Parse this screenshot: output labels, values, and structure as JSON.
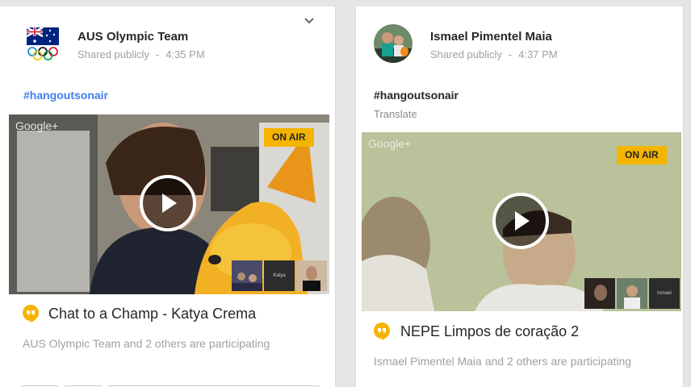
{
  "posts": [
    {
      "author": "AUS Olympic Team",
      "visibility": "Shared publicly",
      "separator": "-",
      "time": "4:35 PM",
      "hashtag": "#hangoutsonair",
      "video": {
        "watermark": "Google+",
        "status_badge": "ON AIR",
        "thumb_label": "Katya"
      },
      "hangout_title": "Chat to a Champ - Katya Crema",
      "participants_text": "AUS Olympic Team and 2 others are participating"
    },
    {
      "author": "Ismael Pimentel Maia",
      "visibility": "Shared publicly",
      "separator": "-",
      "time": "4:37 PM",
      "hashtag": "#hangoutsonair",
      "translate_label": "Translate",
      "video": {
        "watermark": "Google+",
        "status_badge": "ON AIR",
        "thumb_label": "Ismael"
      },
      "hangout_title": "NEPE Limpos de coração 2",
      "participants_text": "Ismael Pimentel Maia and 2 others are participating"
    }
  ],
  "colors": {
    "hashtag_link": "#427fed",
    "on_air_badge": "#f4b400",
    "hangout_icon": "#f4b400",
    "page_bg": "#e5e5e5"
  },
  "icons": [
    "chevron-down-icon",
    "play-icon",
    "hangouts-icon",
    "google-plus-icon"
  ]
}
